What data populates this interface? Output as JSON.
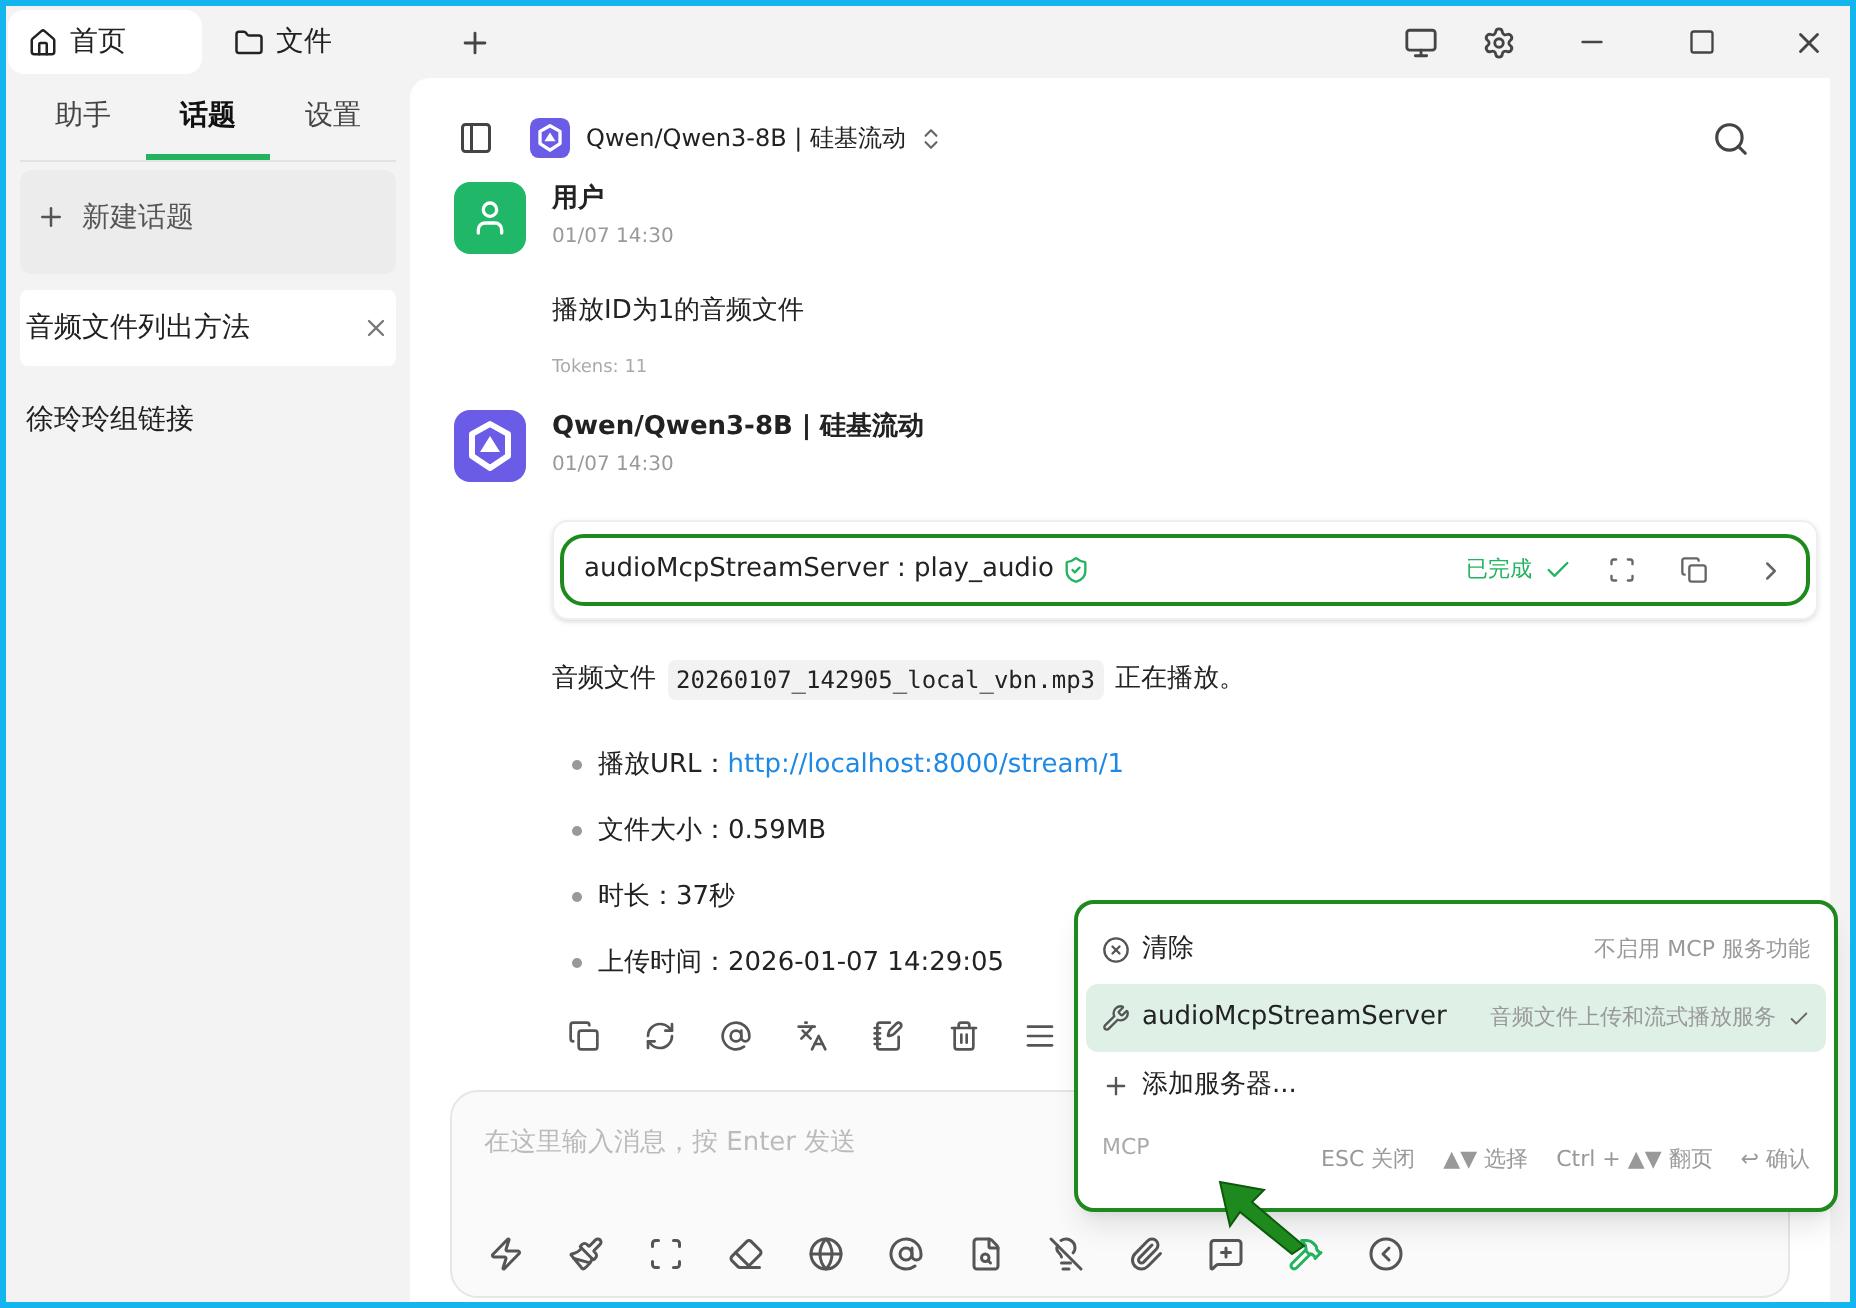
{
  "title_tabs": [
    {
      "label": "首页",
      "kind": "home",
      "selected": true
    },
    {
      "label": "文件",
      "kind": "folder",
      "selected": false
    }
  ],
  "sidebar": {
    "tabs": [
      {
        "label": "助手",
        "selected": false
      },
      {
        "label": "话题",
        "selected": true
      },
      {
        "label": "设置",
        "selected": false
      }
    ],
    "new_topic": "新建话题",
    "topics": [
      {
        "label": "音频文件列出方法",
        "selected": true
      },
      {
        "label": "徐玲玲组链接",
        "selected": false
      }
    ]
  },
  "header": {
    "model": "Qwen/Qwen3-8B | 硅基流动"
  },
  "messages": [
    {
      "kind": "user",
      "name": "用户",
      "time": "01/07 14:30",
      "text": "播放ID为1的音频文件",
      "tokens": "Tokens: 11"
    },
    {
      "kind": "assistant",
      "name": "Qwen/Qwen3-8B | 硅基流动",
      "time": "01/07 14:30",
      "tool_call": {
        "label": "audioMcpStreamServer : play_audio",
        "status": "已完成"
      },
      "paragraph": {
        "before": "音频文件",
        "code": "20260107_142905_local_vbn.mp3",
        "after": "正在播放。"
      },
      "bullets": [
        {
          "kind": "link",
          "label": "播放URL：",
          "value": "http://localhost:8000/stream/1"
        },
        {
          "kind": "text",
          "label": "文件大小：",
          "value": "0.59MB"
        },
        {
          "kind": "text",
          "label": "时长：",
          "value": "37秒"
        },
        {
          "kind": "text",
          "label": "上传时间：",
          "value": "2026-01-07 14:29:05"
        }
      ]
    }
  ],
  "composer": {
    "placeholder": "在这里输入消息，按 Enter 发送",
    "mcp_active": true
  },
  "mcp_menu": {
    "items": [
      {
        "kind": "clear",
        "label": "清除",
        "hint": "不启用 MCP 服务功能",
        "selected": false
      },
      {
        "kind": "server",
        "label": "audioMcpStreamServer",
        "hint": "音频文件上传和流式播放服务",
        "selected": true
      },
      {
        "kind": "add",
        "label": "添加服务器...",
        "selected": false
      }
    ],
    "footer_label": "MCP",
    "shortcuts": [
      "ESC 关闭",
      "▲▼ 选择",
      "Ctrl + ▲▼ 翻页",
      "↩ 确认"
    ]
  }
}
